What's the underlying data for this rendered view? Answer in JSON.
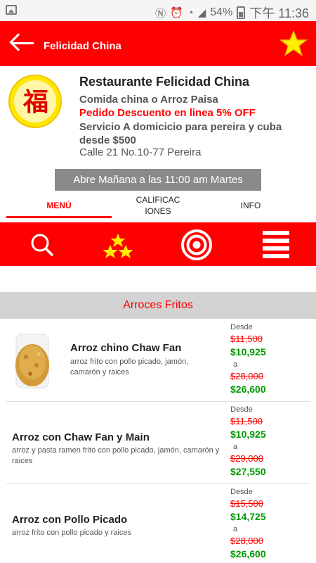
{
  "status_bar": {
    "battery": "54%",
    "time": "下午 11:36"
  },
  "app_bar": {
    "title": "Felicidad China"
  },
  "restaurant": {
    "name": "Restaurante Felicidad China",
    "category": "Comida china o Arroz Paisa",
    "discount": "Pedido Descuento en linea 5% OFF",
    "delivery": "Servicio A domicicio para pereira y cuba desde $500",
    "address": "Calle 21 No.10-77 Pereira",
    "logo_text": "福"
  },
  "open_status": "Abre Mañana a las 11:00 am Martes",
  "tabs": [
    {
      "label": "MENÚ",
      "active": true
    },
    {
      "label": "CALIFICAC IONES",
      "active": false
    },
    {
      "label": "INFO",
      "active": false
    }
  ],
  "tabs_lines": {
    "calif_line1": "CALIFICAC",
    "calif_line2": "IONES"
  },
  "icon_bar": {
    "icons": [
      "search-icon",
      "stars-icon",
      "target-icon",
      "menu-list-icon"
    ]
  },
  "section": {
    "title": "Arroces Fritos"
  },
  "menu_items": [
    {
      "name": "Arroz chino Chaw Fan",
      "description": "arroz frito con pollo picado, jamón, camarón y raices",
      "from_label": "Desde",
      "price_from_old": "$11,500",
      "price_from_new": "$10,925",
      "to_label": "a",
      "price_to_old": "$28,000",
      "price_to_new": "$26,600"
    },
    {
      "name": "Arroz con Chaw Fan y Main",
      "description": "arroz y pasta ramen frito con pollo picado, jamón, camarón y raices",
      "from_label": "Desde",
      "price_from_old": "$11,500",
      "price_from_new": "$10,925",
      "to_label": "a",
      "price_to_old": "$29,000",
      "price_to_new": "$27,550"
    },
    {
      "name": "Arroz con Pollo Picado",
      "description": "arroz frito con pollo picado y raices",
      "from_label": "Desde",
      "price_from_old": "$15,500",
      "price_from_new": "$14,725",
      "to_label": "a",
      "price_to_old": "$28,000",
      "price_to_new": "$26,600"
    }
  ],
  "colors": {
    "primary": "#ff0000",
    "price_new": "#009900",
    "banner_bg": "#8a8a8a",
    "section_bg": "#d3d3d3",
    "star": "#ffee00"
  }
}
